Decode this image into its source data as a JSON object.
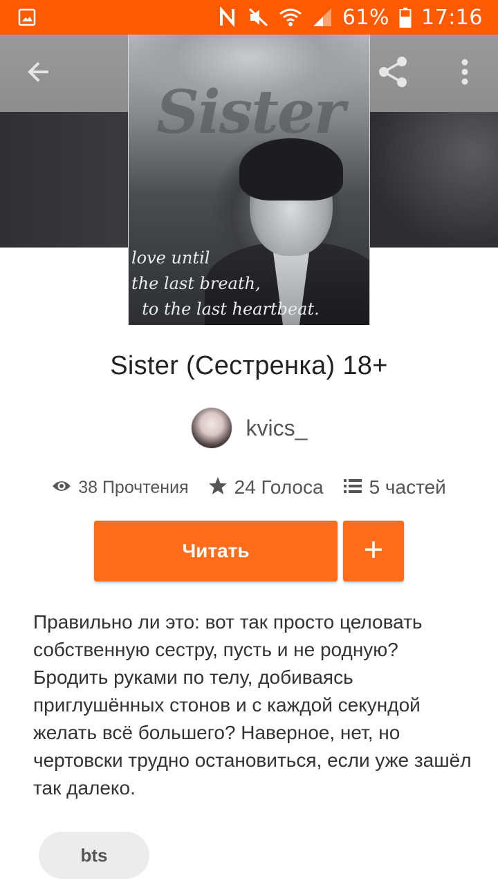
{
  "status_bar": {
    "battery_percent": "61%",
    "time": "17:16",
    "icons": [
      "gallery-icon",
      "nfc-icon",
      "mute-icon",
      "wifi-icon",
      "signal-icon",
      "battery-icon"
    ]
  },
  "toolbar": {
    "back_icon": "arrow-left-icon",
    "share_icon": "share-icon",
    "more_icon": "more-vert-icon"
  },
  "cover": {
    "title_text": "Sister",
    "quote_text": "love until\nthe last breath,\n  to the last heartbeat."
  },
  "story": {
    "title": "Sister (Сестренка) 18+",
    "author": "kvics_",
    "stats": {
      "reads": "38 Прочтения",
      "votes": "24 Голоса",
      "parts": "5 частей"
    },
    "read_button": "Читать",
    "add_button_icon": "plus-icon",
    "description": "Правильно ли это: вот так просто целовать собственную сестру, пусть и не родную? Бродить руками по телу, добиваясь приглушённых стонов и с каждой секундой желать всё большего? Наверное, нет, но чертовски трудно остановиться, если уже зашёл так далеко.",
    "tags": [
      "bts"
    ]
  },
  "colors": {
    "accent": "#ff6c1a",
    "status_bar": "#ff5a00"
  }
}
